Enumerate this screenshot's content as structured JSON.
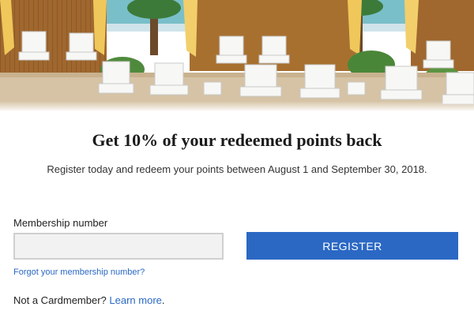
{
  "hero": {
    "image_alt": "Beach cabanas with white lounge chairs and palm trees",
    "colors": {
      "sky": "#cfe4ea",
      "sea": "#3fa7b3",
      "wood": "#a0672e",
      "sand": "#d6c3a5",
      "drape": "#f0c75a"
    }
  },
  "promo": {
    "headline": "Get 10% of your redeemed points back",
    "subtext": "Register today and redeem your points between August 1 and September 30, 2018."
  },
  "form": {
    "membership_label": "Membership number",
    "membership_value": "",
    "membership_placeholder": "",
    "register_label": "REGISTER",
    "forgot_link": "Forgot your membership number?"
  },
  "footer": {
    "not_member_text": "Not a Cardmember?",
    "learn_more": "Learn more",
    "period": "."
  },
  "colors": {
    "accent": "#2b68c4",
    "input_bg": "#f2f2f2",
    "input_border": "#cfcfcf"
  }
}
